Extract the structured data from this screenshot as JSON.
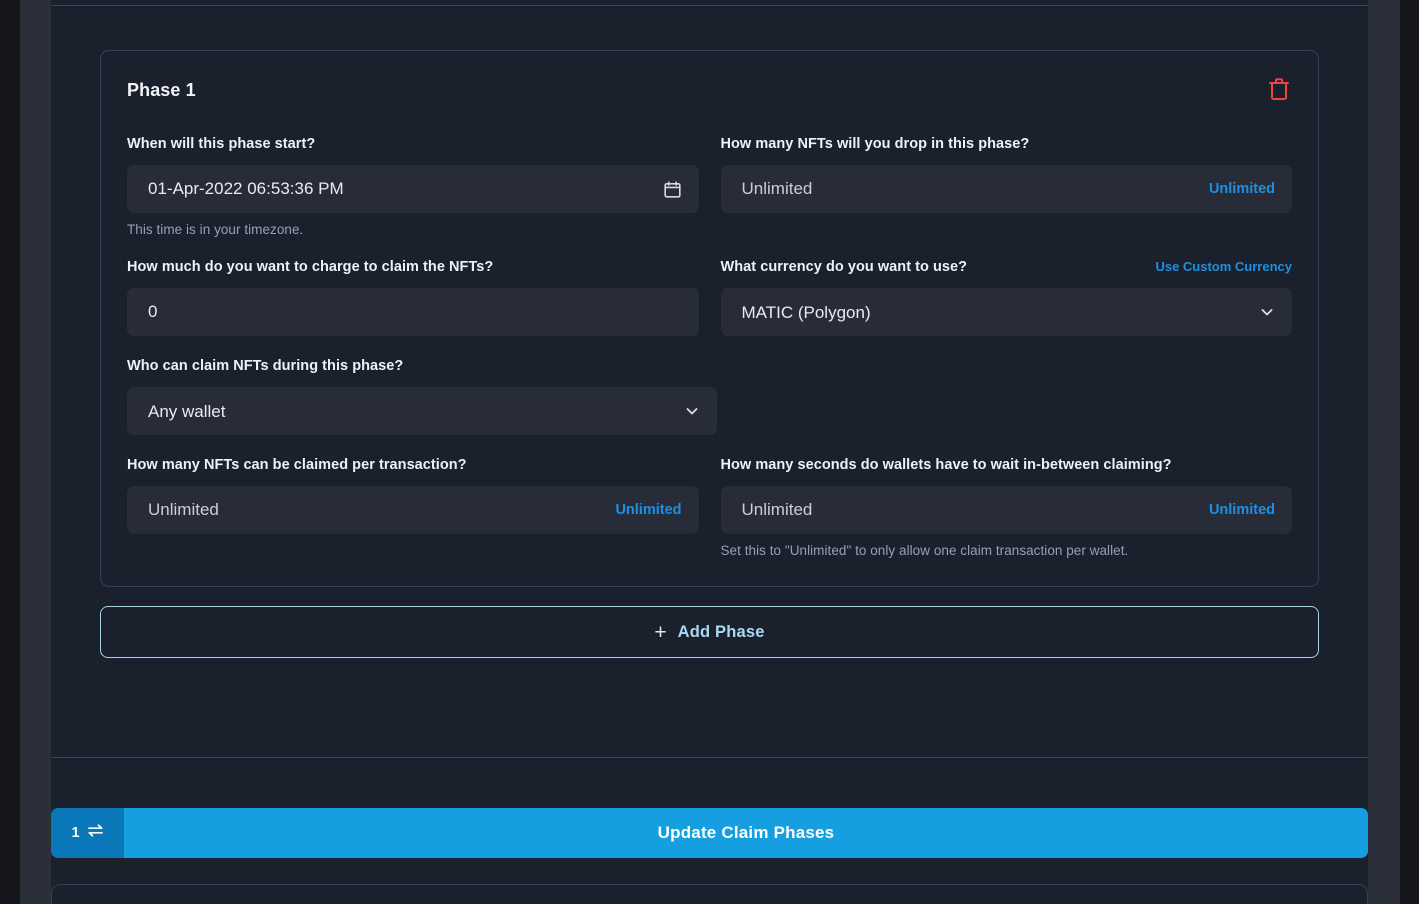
{
  "phase": {
    "title": "Phase 1",
    "delete_icon": "trash-icon",
    "fields": {
      "start_time": {
        "label": "When will this phase start?",
        "value": "01-Apr-2022 06:53:36 PM",
        "icon": "calendar-icon",
        "hint": "This time is in your timezone."
      },
      "quantity": {
        "label": "How many NFTs will you drop in this phase?",
        "value": "Unlimited",
        "suffix": "Unlimited"
      },
      "price": {
        "label": "How much do you want to charge to claim the NFTs?",
        "value": "0"
      },
      "currency": {
        "label": "What currency do you want to use?",
        "action": "Use Custom Currency",
        "value": "MATIC (Polygon)",
        "options": [
          "MATIC (Polygon)"
        ],
        "icon": "chevron-down-icon"
      },
      "who_can_claim": {
        "label": "Who can claim NFTs during this phase?",
        "value": "Any wallet",
        "options": [
          "Any wallet"
        ],
        "icon": "chevron-down-icon"
      },
      "per_transaction": {
        "label": "How many NFTs can be claimed per transaction?",
        "value": "Unlimited",
        "suffix": "Unlimited"
      },
      "wait_seconds": {
        "label": "How many seconds do wallets have to wait in-between claiming?",
        "value": "Unlimited",
        "suffix": "Unlimited",
        "hint": "Set this to \"Unlimited\" to only allow one claim transaction per wallet."
      }
    }
  },
  "add_phase": {
    "plus": "+",
    "label": "Add Phase"
  },
  "action_bar": {
    "network_count": "1",
    "network_icon": "swap-arrows-icon",
    "submit_label": "Update Claim Phases"
  },
  "colors": {
    "accent_blue": "#169fe0",
    "link_blue": "#1f8fe0",
    "danger_red": "#ef4444",
    "card_bg": "#1a202c",
    "input_bg": "#282c38",
    "outline_blue": "#a8d4ec"
  }
}
